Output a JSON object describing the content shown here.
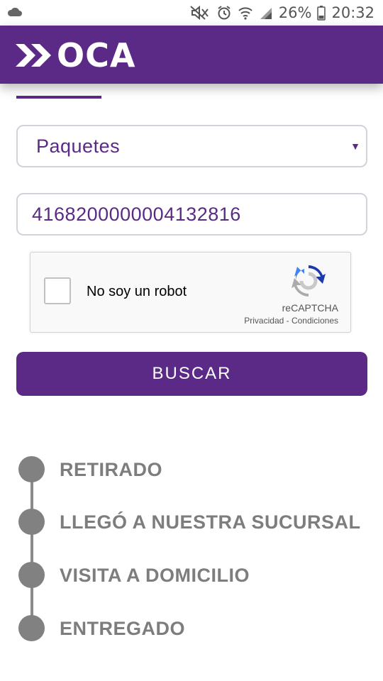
{
  "status_bar": {
    "battery": "26%",
    "time": "20:32",
    "icons": [
      "cloud-icon",
      "mute-icon",
      "alarm-icon",
      "wifi-icon",
      "signal-icon",
      "battery-icon"
    ]
  },
  "header": {
    "logo_text": "OCA",
    "background_color": "#5b2a86"
  },
  "form": {
    "select_value": "Paquetes",
    "tracking_number": "4168200000004132816",
    "recaptcha": {
      "label": "No soy un robot",
      "brand": "reCAPTCHA",
      "links": "Privacidad - Condiciones"
    },
    "button_label": "BUSCAR"
  },
  "timeline": [
    {
      "label": "RETIRADO"
    },
    {
      "label": "LLEGÓ A NUESTRA SUCURSAL"
    },
    {
      "label": "VISITA A DOMICILIO"
    },
    {
      "label": "ENTREGADO"
    }
  ]
}
